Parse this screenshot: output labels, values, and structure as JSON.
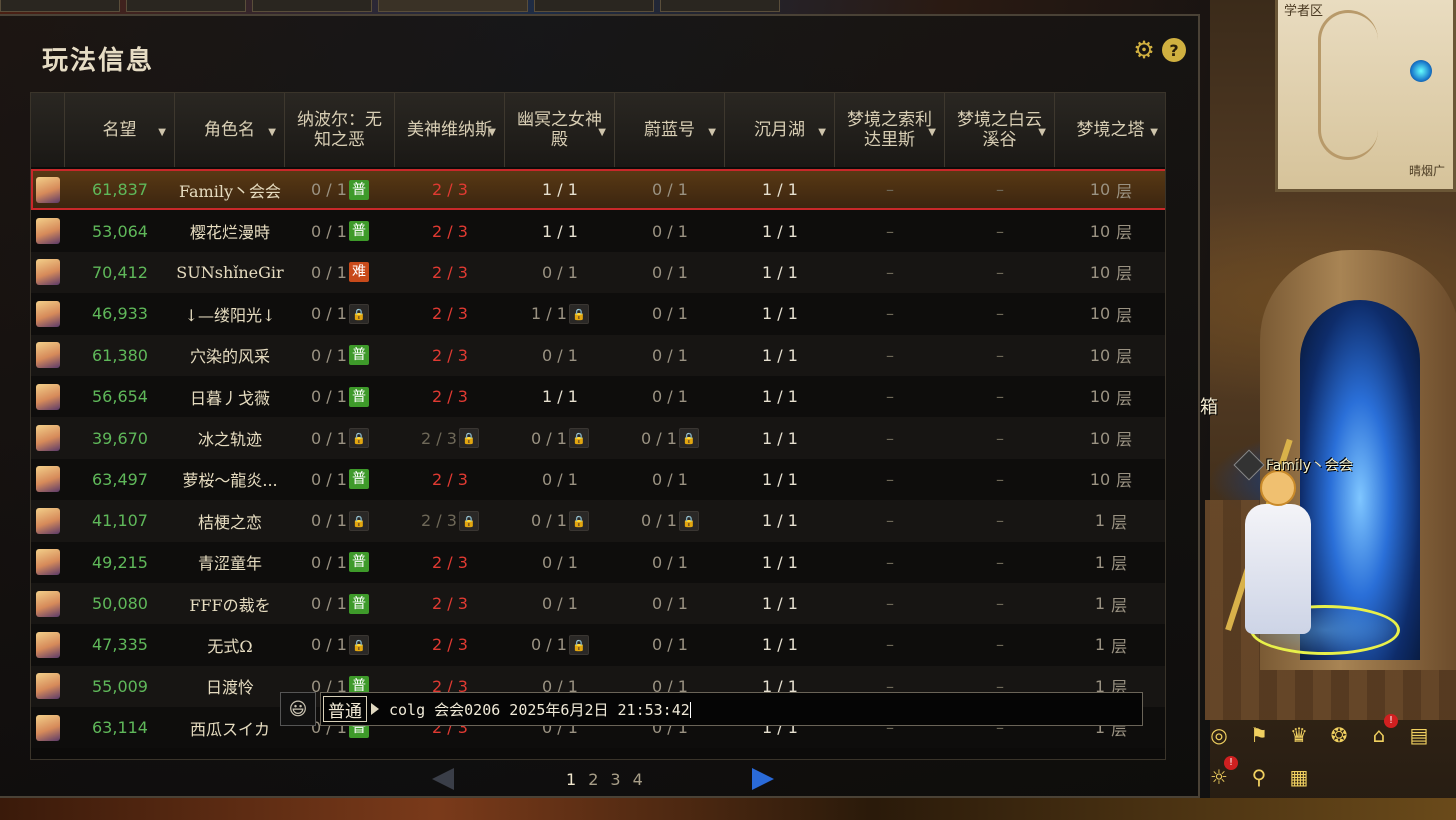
{
  "panel": {
    "title": "玩法信息",
    "settings_icon": "gear-icon",
    "help_icon": "?"
  },
  "columns": [
    {
      "key": "avatar",
      "label": "",
      "sortable": false
    },
    {
      "key": "reputation",
      "label": "名望",
      "sortable": true
    },
    {
      "key": "name",
      "label": "角色名",
      "sortable": true
    },
    {
      "key": "nabal",
      "label": "纳波尔：无知之恶",
      "sortable": false
    },
    {
      "key": "venus",
      "label": "美神维纳斯",
      "sortable": true
    },
    {
      "key": "goddess",
      "label": "幽冥之女神殿",
      "sortable": true
    },
    {
      "key": "azure",
      "label": "蔚蓝号",
      "sortable": true
    },
    {
      "key": "lake",
      "label": "沉月湖",
      "sortable": true
    },
    {
      "key": "solaris",
      "label": "梦境之索利达里斯",
      "sortable": true
    },
    {
      "key": "cloud",
      "label": "梦境之白云溪谷",
      "sortable": true
    },
    {
      "key": "tower",
      "label": "梦境之塔",
      "sortable": true
    }
  ],
  "rows": [
    {
      "rep": "61,837",
      "name": "Family丶会会",
      "nabal": "0 / 1",
      "nabal_badge": "普",
      "venus": "2 / 3",
      "venus_badge": "",
      "goddess": "1 / 1",
      "goddess_badge": "",
      "azure": "0 / 1",
      "azure_badge": "",
      "lake": "1 / 1",
      "solaris": "–",
      "cloud": "–",
      "tower": "10",
      "selected": true
    },
    {
      "rep": "53,064",
      "name": "樱花烂漫時",
      "nabal": "0 / 1",
      "nabal_badge": "普",
      "venus": "2 / 3",
      "venus_badge": "",
      "goddess": "1 / 1",
      "goddess_badge": "",
      "azure": "0 / 1",
      "azure_badge": "",
      "lake": "1 / 1",
      "solaris": "–",
      "cloud": "–",
      "tower": "10"
    },
    {
      "rep": "70,412",
      "name": "SUNshǐneGir",
      "nabal": "0 / 1",
      "nabal_badge": "难",
      "venus": "2 / 3",
      "venus_badge": "",
      "goddess": "0 / 1",
      "goddess_badge": "",
      "azure": "0 / 1",
      "azure_badge": "",
      "lake": "1 / 1",
      "solaris": "–",
      "cloud": "–",
      "tower": "10"
    },
    {
      "rep": "46,933",
      "name": "↓—缕阳光↓",
      "nabal": "0 / 1",
      "nabal_badge": "lock",
      "venus": "2 / 3",
      "venus_badge": "",
      "goddess": "1 / 1",
      "goddess_badge": "lock",
      "azure": "0 / 1",
      "azure_badge": "",
      "lake": "1 / 1",
      "solaris": "–",
      "cloud": "–",
      "tower": "10"
    },
    {
      "rep": "61,380",
      "name": "穴染的风采",
      "nabal": "0 / 1",
      "nabal_badge": "普",
      "venus": "2 / 3",
      "venus_badge": "",
      "goddess": "0 / 1",
      "goddess_badge": "",
      "azure": "0 / 1",
      "azure_badge": "",
      "lake": "1 / 1",
      "solaris": "–",
      "cloud": "–",
      "tower": "10"
    },
    {
      "rep": "56,654",
      "name": "日暮丿戈薇",
      "nabal": "0 / 1",
      "nabal_badge": "普",
      "venus": "2 / 3",
      "venus_badge": "",
      "goddess": "1 / 1",
      "goddess_badge": "",
      "azure": "0 / 1",
      "azure_badge": "",
      "lake": "1 / 1",
      "solaris": "–",
      "cloud": "–",
      "tower": "10"
    },
    {
      "rep": "39,670",
      "name": "冰之轨迹",
      "nabal": "0 / 1",
      "nabal_badge": "lock",
      "venus": "2 / 3",
      "venus_badge": "lock",
      "goddess": "0 / 1",
      "goddess_badge": "lock",
      "azure": "0 / 1",
      "azure_badge": "lock",
      "lake": "1 / 1",
      "solaris": "–",
      "cloud": "–",
      "tower": "10"
    },
    {
      "rep": "63,497",
      "name": "萝桜～龍炎...",
      "nabal": "0 / 1",
      "nabal_badge": "普",
      "venus": "2 / 3",
      "venus_badge": "",
      "goddess": "0 / 1",
      "goddess_badge": "",
      "azure": "0 / 1",
      "azure_badge": "",
      "lake": "1 / 1",
      "solaris": "–",
      "cloud": "–",
      "tower": "10"
    },
    {
      "rep": "41,107",
      "name": "桔梗之恋",
      "nabal": "0 / 1",
      "nabal_badge": "lock",
      "venus": "2 / 3",
      "venus_badge": "lock",
      "goddess": "0 / 1",
      "goddess_badge": "lock",
      "azure": "0 / 1",
      "azure_badge": "lock",
      "lake": "1 / 1",
      "solaris": "–",
      "cloud": "–",
      "tower": "1"
    },
    {
      "rep": "49,215",
      "name": "青涩童年",
      "nabal": "0 / 1",
      "nabal_badge": "普",
      "venus": "2 / 3",
      "venus_badge": "",
      "goddess": "0 / 1",
      "goddess_badge": "",
      "azure": "0 / 1",
      "azure_badge": "",
      "lake": "1 / 1",
      "solaris": "–",
      "cloud": "–",
      "tower": "1"
    },
    {
      "rep": "50,080",
      "name": "FFFの裁を",
      "nabal": "0 / 1",
      "nabal_badge": "普",
      "venus": "2 / 3",
      "venus_badge": "",
      "goddess": "0 / 1",
      "goddess_badge": "",
      "azure": "0 / 1",
      "azure_badge": "",
      "lake": "1 / 1",
      "solaris": "–",
      "cloud": "–",
      "tower": "1"
    },
    {
      "rep": "47,335",
      "name": "无式Ω",
      "nabal": "0 / 1",
      "nabal_badge": "lock",
      "venus": "2 / 3",
      "venus_badge": "",
      "goddess": "0 / 1",
      "goddess_badge": "lock",
      "azure": "0 / 1",
      "azure_badge": "",
      "lake": "1 / 1",
      "solaris": "–",
      "cloud": "–",
      "tower": "1"
    },
    {
      "rep": "55,009",
      "name": "日渡怜",
      "nabal": "0 / 1",
      "nabal_badge": "普",
      "venus": "2 / 3",
      "venus_badge": "",
      "goddess": "0 / 1",
      "goddess_badge": "",
      "azure": "0 / 1",
      "azure_badge": "",
      "lake": "1 / 1",
      "solaris": "–",
      "cloud": "–",
      "tower": "1"
    },
    {
      "rep": "63,114",
      "name": "西瓜スイカ",
      "nabal": "0 / 1",
      "nabal_badge": "普",
      "venus": "2 / 3",
      "venus_badge": "",
      "goddess": "0 / 1",
      "goddess_badge": "",
      "azure": "0 / 1",
      "azure_badge": "",
      "lake": "1 / 1",
      "solaris": "–",
      "cloud": "–",
      "tower": "1"
    }
  ],
  "tower_unit": "层",
  "pagination": {
    "pages": [
      "1",
      "2",
      "3",
      "4"
    ],
    "current": "1"
  },
  "chat": {
    "channel": "普通",
    "text": "colg 会会0206 2025年6月2日 21:53:42"
  },
  "scene": {
    "minimap_area": "学者区",
    "minimap_area2": "晴烟广",
    "character_name": "Family丶会会",
    "side_label": "箱"
  },
  "hud_icons": [
    "target-icon",
    "flag-icon",
    "crown-icon",
    "treasure-icon",
    "house-icon",
    "chest-icon",
    "pet-icon",
    "map-pin-icon",
    "book-icon"
  ]
}
